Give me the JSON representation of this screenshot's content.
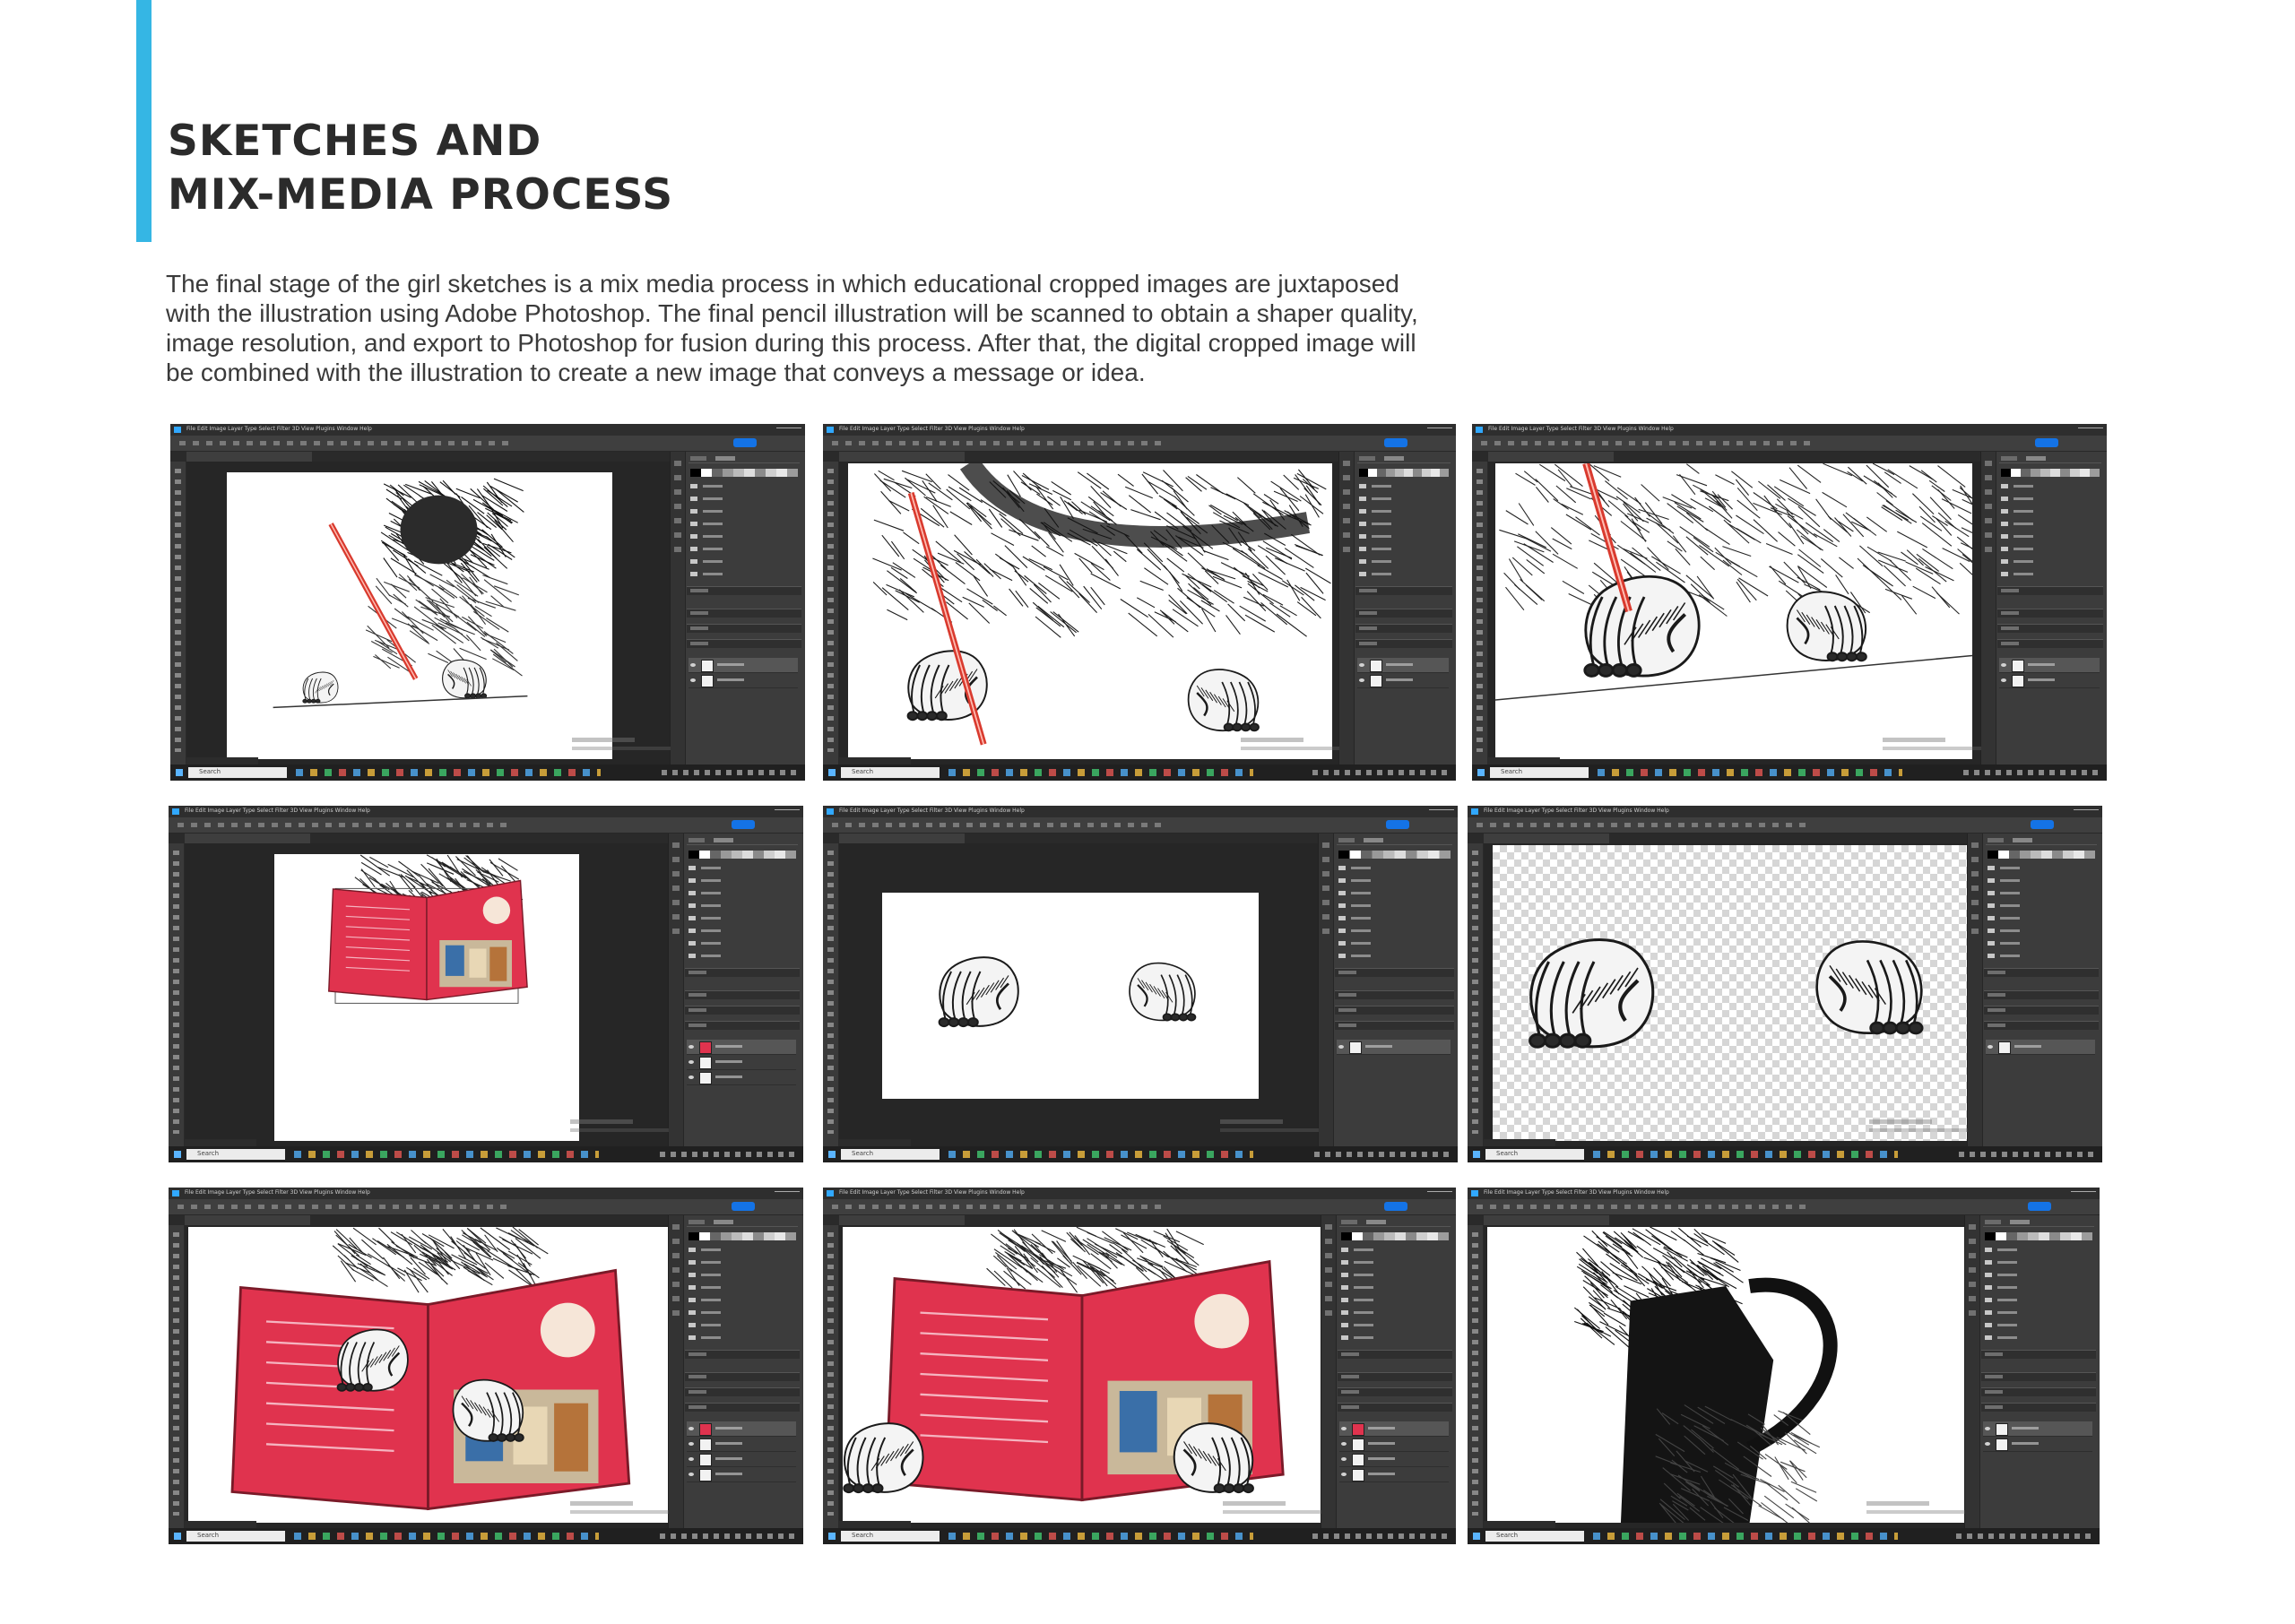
{
  "heading": {
    "line1": "SKETCHES AND",
    "line2": "MIX-MEDIA PROCESS"
  },
  "body": {
    "line1": "The final stage of the girl sketches is a mix media process in which educational cropped images are juxtaposed",
    "line2": "with the illustration using Adobe Photoshop. The final pencil illustration will be scanned to obtain a shaper quality,",
    "line3": "image resolution, and export to Photoshop for fusion during this process. After that, the digital cropped image will",
    "line4": "be combined with the illustration to create a new image that conveys a message or idea."
  },
  "screens": [
    {
      "content": "pencil sketch of girl with braids drawing with red pencil",
      "canvas_style": "solid",
      "layers": 2
    },
    {
      "content": "zoomed sketch of shoulders and hands with red pencil",
      "canvas_style": "solid",
      "layers": 2
    },
    {
      "content": "close-up of hand holding red pencil",
      "canvas_style": "solid",
      "layers": 2
    },
    {
      "content": "pink textbook placed over sketch with transform box",
      "canvas_style": "solid",
      "layers": 3
    },
    {
      "content": "two cut-out sketched hands on canvas",
      "canvas_style": "solid",
      "layers": 1
    },
    {
      "content": "two sketched hands on transparent background",
      "canvas_style": "transparent",
      "layers": 1
    },
    {
      "content": "sketched hands holding pink textbook",
      "canvas_style": "solid",
      "layers": 4
    },
    {
      "content": "hands holding pink textbook with classroom photo",
      "canvas_style": "solid",
      "layers": 4
    },
    {
      "content": "dark sketch with black jacket and braided hair",
      "canvas_style": "solid",
      "layers": 2
    }
  ],
  "ui": {
    "menu_text": "File  Edit  Image  Layer  Type  Select  Filter  3D  View  Plugins  Window  Help",
    "taskbar_search": "Search"
  },
  "colors": {
    "accent": "#35b6e4",
    "pencil_red": "#d93a2e",
    "book_pink": "#e0334e",
    "ps_dark": "#535353"
  }
}
